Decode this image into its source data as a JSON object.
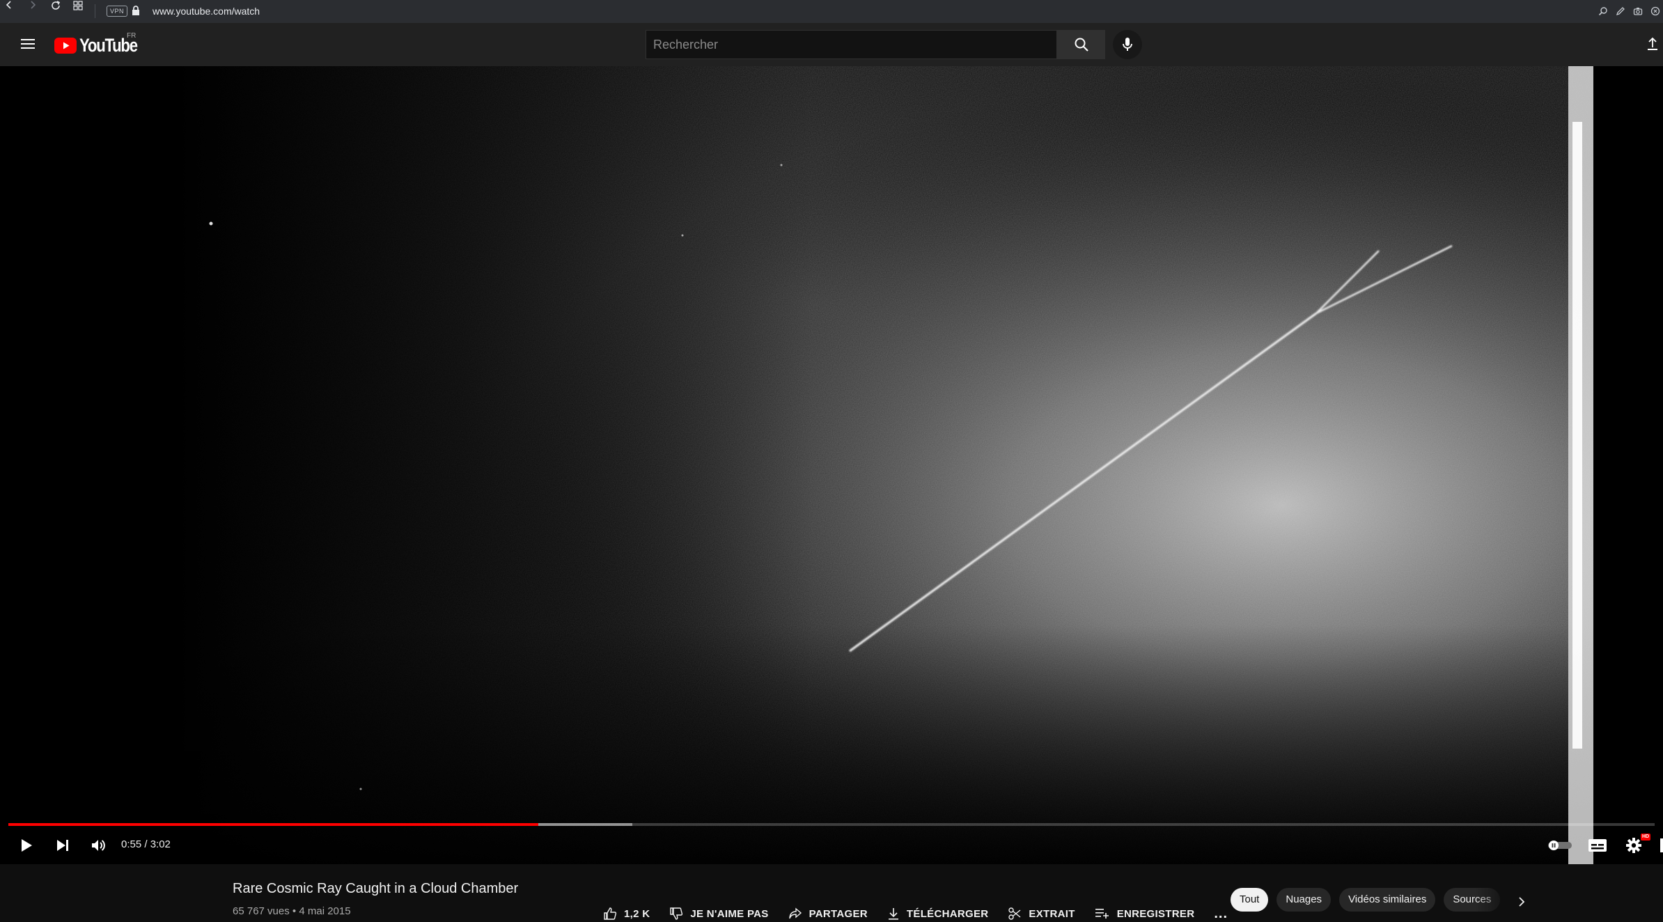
{
  "browser": {
    "url": "www.youtube.com/watch",
    "vpn_label": "VPN"
  },
  "header": {
    "logo_text": "YouTube",
    "country_code": "FR",
    "search_placeholder": "Rechercher"
  },
  "player": {
    "time": "0:55 / 3:02",
    "played_fraction": 0.322,
    "buffered_fraction": 0.379,
    "hd_badge": "HD"
  },
  "video": {
    "title": "Rare Cosmic Ray Caught in a Cloud Chamber",
    "views": "65 767 vues",
    "separator": "•",
    "date": "4 mai 2015"
  },
  "actions": {
    "like": "1,2 K",
    "dislike": "JE N'AIME PAS",
    "share": "PARTAGER",
    "download": "TÉLÉCHARGER",
    "clip": "EXTRAIT",
    "save": "ENREGISTRER",
    "more": "..."
  },
  "chips": [
    "Tout",
    "Nuages",
    "Vidéos similaires",
    "Sources"
  ],
  "colors": {
    "accent_red": "#ff0000",
    "background": "#0f0f0f",
    "header": "#212121"
  }
}
